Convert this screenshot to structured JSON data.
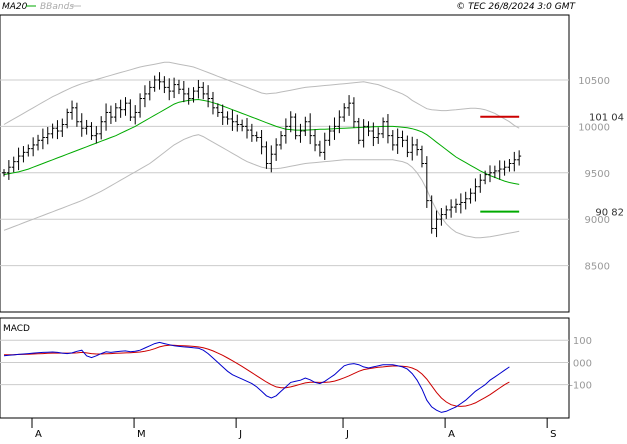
{
  "header": {
    "indicators": [
      {
        "label": "MA20",
        "color": "#00aa00"
      },
      {
        "label": "BBands",
        "color": "#aaaaaa"
      }
    ],
    "source": "© TEC 26/8/2024 3:0 GMT"
  },
  "colors": {
    "price_bar": "#000000",
    "ma20": "#00aa00",
    "bbands": "#bbbbbb",
    "grid": "#cccccc",
    "resistance": "#cc0000",
    "support": "#00aa00",
    "macd_line": "#0000cc",
    "macd_signal": "#cc0000"
  },
  "chart_data": [
    {
      "type": "ohlc",
      "name": "price",
      "y_axis": {
        "ticks": [
          "10500",
          "10000",
          "9500",
          "9000",
          "8500"
        ],
        "min": 8000,
        "max": 11200
      },
      "x_axis": {
        "labels": [
          "A",
          "M",
          "J",
          "J",
          "A",
          "S"
        ],
        "label_index": [
          0,
          21,
          42,
          64,
          85,
          106
        ]
      },
      "grid": true,
      "levels": [
        {
          "label": "101 04",
          "value": 10104,
          "color": "#cc0000",
          "start_index": 98,
          "end_index": 106
        },
        {
          "label": "90 82",
          "value": 9082,
          "color": "#00aa00",
          "start_index": 98,
          "end_index": 106
        }
      ],
      "close": [
        9500,
        9560,
        9620,
        9680,
        9720,
        9760,
        9800,
        9850,
        9880,
        9920,
        9980,
        9950,
        10020,
        10150,
        10200,
        10050,
        9980,
        10000,
        9900,
        9920,
        10050,
        10150,
        10100,
        10200,
        10180,
        10250,
        10100,
        10150,
        10300,
        10350,
        10420,
        10500,
        10480,
        10420,
        10380,
        10450,
        10400,
        10350,
        10300,
        10380,
        10420,
        10350,
        10300,
        10200,
        10150,
        10100,
        10080,
        10050,
        10020,
        10000,
        9960,
        9900,
        9880,
        9780,
        9600,
        9700,
        9800,
        9900,
        10000,
        10100,
        9900,
        9950,
        10050,
        9900,
        9800,
        9720,
        9850,
        9950,
        10000,
        10100,
        10200,
        10250,
        10050,
        9850,
        10000,
        9950,
        9880,
        9920,
        10050,
        9900,
        9800,
        9880,
        9850,
        9720,
        9800,
        9750,
        9600,
        9200,
        8900,
        9000,
        9050,
        9100,
        9130,
        9160,
        9180,
        9220,
        9280,
        9350,
        9420,
        9480,
        9500,
        9520,
        9540,
        9560,
        9600,
        9640,
        9680
      ],
      "ma20": [
        9480,
        9490,
        9500,
        9510,
        9525,
        9540,
        9560,
        9580,
        9600,
        9620,
        9640,
        9660,
        9680,
        9700,
        9720,
        9740,
        9760,
        9780,
        9800,
        9820,
        9840,
        9860,
        9880,
        9900,
        9925,
        9950,
        9975,
        10000,
        10030,
        10060,
        10090,
        10120,
        10150,
        10180,
        10210,
        10240,
        10260,
        10270,
        10280,
        10285,
        10290,
        10280,
        10270,
        10255,
        10240,
        10220,
        10200,
        10180,
        10160,
        10140,
        10120,
        10100,
        10080,
        10060,
        10040,
        10020,
        10000,
        9985,
        9970,
        9965,
        9960,
        9960,
        9960,
        9962,
        9965,
        9968,
        9970,
        9972,
        9975,
        9978,
        9980,
        9982,
        9985,
        9988,
        9990,
        9992,
        9995,
        9998,
        10000,
        10000,
        10000,
        9995,
        9990,
        9985,
        9975,
        9960,
        9940,
        9910,
        9870,
        9830,
        9790,
        9750,
        9710,
        9670,
        9640,
        9610,
        9580,
        9550,
        9520,
        9495,
        9470,
        9450,
        9430,
        9410,
        9395,
        9385,
        9375
      ],
      "bb_upper": [
        10020,
        10050,
        10080,
        10110,
        10140,
        10170,
        10200,
        10230,
        10260,
        10290,
        10320,
        10345,
        10370,
        10395,
        10420,
        10440,
        10460,
        10475,
        10490,
        10505,
        10520,
        10535,
        10550,
        10565,
        10580,
        10595,
        10610,
        10625,
        10640,
        10650,
        10660,
        10670,
        10680,
        10690,
        10690,
        10680,
        10670,
        10660,
        10650,
        10640,
        10620,
        10600,
        10580,
        10560,
        10540,
        10520,
        10500,
        10480,
        10460,
        10440,
        10420,
        10400,
        10380,
        10360,
        10350,
        10355,
        10360,
        10370,
        10380,
        10390,
        10400,
        10410,
        10420,
        10425,
        10430,
        10435,
        10440,
        10445,
        10450,
        10455,
        10460,
        10465,
        10470,
        10475,
        10480,
        10470,
        10460,
        10450,
        10430,
        10410,
        10390,
        10370,
        10350,
        10320,
        10280,
        10250,
        10220,
        10190,
        10180,
        10175,
        10170,
        10170,
        10175,
        10180,
        10185,
        10190,
        10195,
        10195,
        10190,
        10180,
        10160,
        10140,
        10110,
        10080,
        10050,
        10010,
        9980
      ],
      "bb_lower": [
        8880,
        8900,
        8920,
        8940,
        8960,
        8980,
        9000,
        9020,
        9040,
        9060,
        9080,
        9100,
        9120,
        9140,
        9160,
        9180,
        9200,
        9225,
        9250,
        9275,
        9300,
        9330,
        9360,
        9390,
        9420,
        9450,
        9480,
        9510,
        9540,
        9570,
        9600,
        9640,
        9680,
        9720,
        9760,
        9800,
        9830,
        9860,
        9880,
        9900,
        9910,
        9890,
        9860,
        9830,
        9800,
        9770,
        9740,
        9710,
        9680,
        9650,
        9620,
        9600,
        9580,
        9560,
        9550,
        9545,
        9545,
        9550,
        9560,
        9570,
        9580,
        9590,
        9600,
        9605,
        9610,
        9615,
        9620,
        9625,
        9630,
        9635,
        9640,
        9640,
        9640,
        9640,
        9640,
        9640,
        9640,
        9640,
        9640,
        9640,
        9640,
        9630,
        9620,
        9600,
        9560,
        9500,
        9420,
        9320,
        9200,
        9100,
        9020,
        8950,
        8900,
        8860,
        8840,
        8820,
        8810,
        8800,
        8800,
        8805,
        8810,
        8820,
        8830,
        8840,
        8850,
        8860,
        8870
      ]
    },
    {
      "type": "line",
      "name": "macd_panel",
      "title": "MACD",
      "y_axis": {
        "ticks": [
          "100",
          "000",
          "-100"
        ],
        "min": -250,
        "max": 200
      },
      "series": [
        {
          "name": "MACD",
          "color": "#0000cc",
          "values": [
            30,
            32,
            34,
            36,
            38,
            40,
            42,
            44,
            45,
            46,
            47,
            45,
            42,
            40,
            43,
            50,
            55,
            30,
            22,
            30,
            40,
            48,
            45,
            48,
            50,
            52,
            48,
            50,
            55,
            65,
            75,
            85,
            90,
            85,
            80,
            75,
            72,
            70,
            68,
            66,
            64,
            55,
            40,
            20,
            0,
            -20,
            -40,
            -55,
            -65,
            -75,
            -85,
            -95,
            -110,
            -130,
            -150,
            -160,
            -150,
            -130,
            -110,
            -90,
            -85,
            -80,
            -70,
            -78,
            -90,
            -95,
            -85,
            -70,
            -55,
            -35,
            -15,
            -8,
            -5,
            -10,
            -20,
            -25,
            -20,
            -15,
            -10,
            -10,
            -10,
            -15,
            -20,
            -30,
            -50,
            -80,
            -120,
            -170,
            -200,
            -215,
            -225,
            -220,
            -210,
            -200,
            -185,
            -170,
            -150,
            -130,
            -115,
            -100,
            -80,
            -65,
            -50,
            -35,
            -20
          ]
        },
        {
          "name": "Signal",
          "color": "#cc0000",
          "values": [
            35,
            35,
            35,
            36,
            36,
            37,
            38,
            39,
            40,
            41,
            42,
            42,
            42,
            42,
            42,
            43,
            45,
            43,
            40,
            38,
            38,
            39,
            40,
            41,
            42,
            43,
            44,
            45,
            47,
            50,
            55,
            62,
            70,
            75,
            77,
            77,
            76,
            75,
            74,
            72,
            70,
            66,
            60,
            52,
            42,
            32,
            20,
            8,
            -5,
            -18,
            -32,
            -46,
            -60,
            -74,
            -88,
            -100,
            -110,
            -114,
            -114,
            -110,
            -104,
            -98,
            -92,
            -89,
            -89,
            -90,
            -90,
            -88,
            -84,
            -77,
            -69,
            -60,
            -50,
            -40,
            -32,
            -28,
            -25,
            -22,
            -20,
            -18,
            -16,
            -16,
            -17,
            -19,
            -25,
            -35,
            -52,
            -75,
            -105,
            -135,
            -160,
            -178,
            -190,
            -196,
            -198,
            -196,
            -190,
            -182,
            -170,
            -158,
            -145,
            -130,
            -115,
            -100,
            -88
          ]
        }
      ]
    }
  ]
}
